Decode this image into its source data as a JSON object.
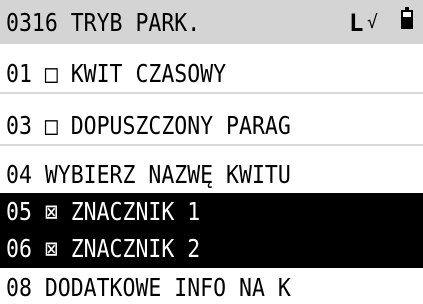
{
  "header": {
    "title": "0316 TRYB PARK.",
    "status_letter": "L",
    "signal_glyph": "√",
    "battery": "battery-icon"
  },
  "menu": {
    "items": [
      {
        "text": "01 □ KWIT CZASOWY",
        "selected": false
      },
      {
        "text": "03 □ DOPUSZCZONY PARAG",
        "selected": false
      },
      {
        "text": "04 WYBIERZ NAZWĘ KWITU",
        "selected": false
      },
      {
        "text": "05 ⊠ ZNACZNIK 1",
        "selected": true
      },
      {
        "text": "06 ⊠ ZNACZNIK 2",
        "selected": true
      },
      {
        "text": "08 DODATKOWE INFO NA K",
        "selected": false
      }
    ]
  },
  "colors": {
    "header_bg": "#d4d4d4",
    "selected_bg": "#000000",
    "selected_fg": "#ffffff",
    "text": "#000000"
  }
}
